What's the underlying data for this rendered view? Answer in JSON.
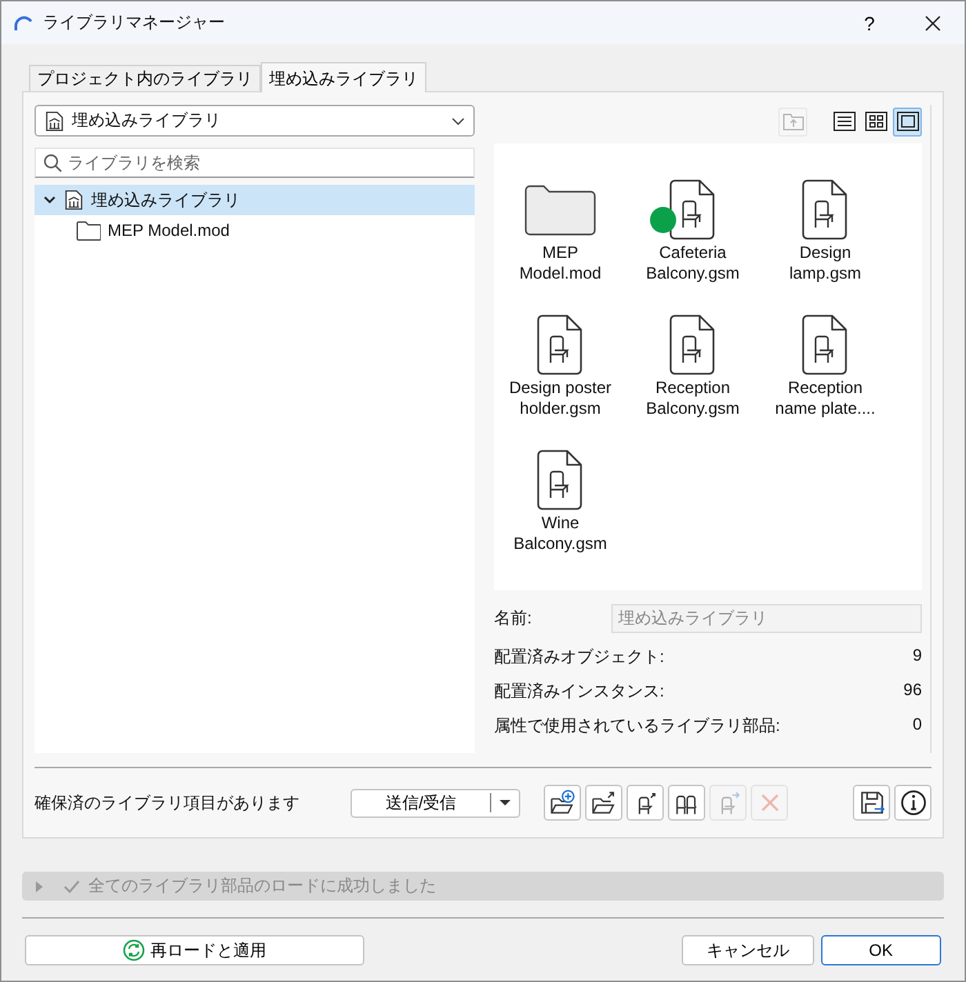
{
  "window": {
    "title": "ライブラリマネージャー",
    "help": "?"
  },
  "tabs": [
    {
      "label": "プロジェクト内のライブラリ",
      "selected": false
    },
    {
      "label": "埋め込みライブラリ",
      "selected": true
    }
  ],
  "library_dropdown": {
    "value": "埋め込みライブラリ"
  },
  "search": {
    "placeholder": "ライブラリを検索"
  },
  "tree": [
    {
      "label": "埋め込みライブラリ",
      "kind": "library",
      "expanded": true,
      "selected": true,
      "children": [
        {
          "label": "MEP Model.mod",
          "kind": "folder",
          "selected": false
        }
      ]
    }
  ],
  "up_button": {
    "disabled": true
  },
  "view_modes": [
    {
      "kind": "list",
      "selected": false
    },
    {
      "kind": "grid",
      "selected": false
    },
    {
      "kind": "large",
      "selected": true
    }
  ],
  "items": [
    {
      "name": "MEP Model.mod",
      "kind": "folder",
      "indicator": false
    },
    {
      "name": "Cafeteria Balcony.gsm",
      "kind": "object",
      "indicator": true
    },
    {
      "name": "Design lamp.gsm",
      "kind": "object",
      "indicator": false
    },
    {
      "name": "Design poster holder.gsm",
      "kind": "object",
      "indicator": false
    },
    {
      "name": "Reception Balcony.gsm",
      "kind": "object",
      "indicator": false
    },
    {
      "name": "Reception name plate....",
      "kind": "object",
      "indicator": false
    },
    {
      "name": "Wine Balcony.gsm",
      "kind": "object",
      "indicator": false
    }
  ],
  "details": {
    "name_label": "名前:",
    "name_value": "埋め込みライブラリ",
    "stats": [
      {
        "label": "配置済みオブジェクト:",
        "value": "9"
      },
      {
        "label": "配置済みインスタンス:",
        "value": "96"
      },
      {
        "label": "属性で使用されているライブラリ部品:",
        "value": "0"
      }
    ]
  },
  "reserve": {
    "text": "確保済のライブラリ項目があります",
    "button": "送信/受信"
  },
  "tools": [
    {
      "kind": "new-library",
      "disabled": false
    },
    {
      "kind": "export-folder",
      "disabled": false
    },
    {
      "kind": "export-object",
      "disabled": false
    },
    {
      "kind": "objects",
      "disabled": false
    },
    {
      "kind": "move-object",
      "disabled": true
    },
    {
      "kind": "remove",
      "disabled": true
    }
  ],
  "side_tools": [
    {
      "kind": "save",
      "disabled": false
    },
    {
      "kind": "info",
      "disabled": false
    }
  ],
  "status": {
    "text": "全てのライブラリ部品のロードに成功しました",
    "expanded": false
  },
  "footer": {
    "reload": "再ロードと適用",
    "cancel": "キャンセル",
    "ok": "OK",
    "ok_default": true
  }
}
